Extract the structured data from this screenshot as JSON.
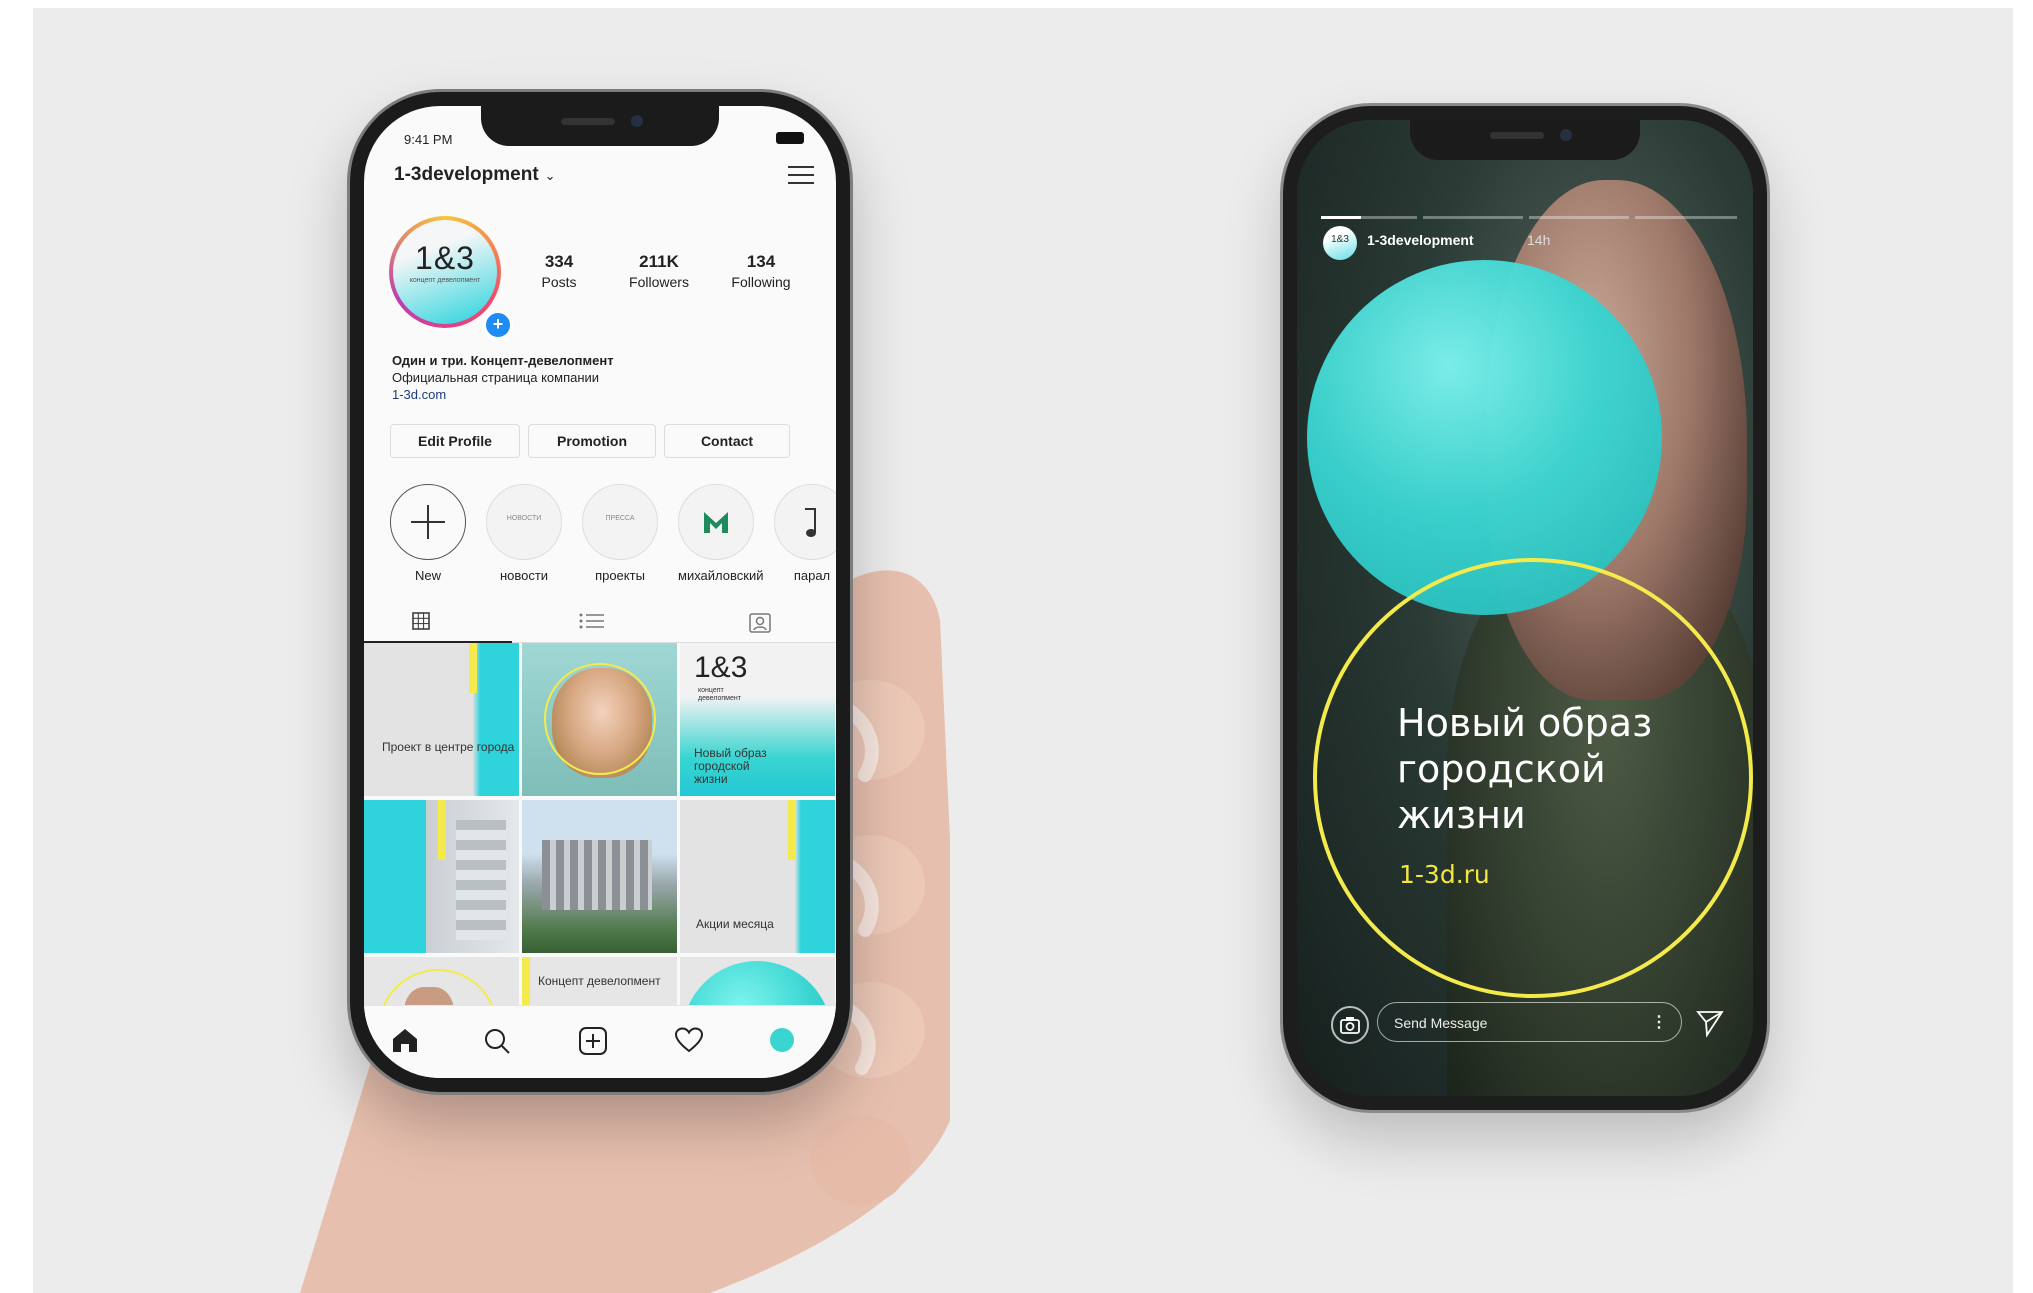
{
  "profile_phone": {
    "status_time": "9:41 PM",
    "username": "1-3development",
    "avatar": {
      "logo": "1&3",
      "subtitle": "концепт девелопмент"
    },
    "stats": [
      {
        "value": "334",
        "label": "Posts"
      },
      {
        "value": "211K",
        "label": "Followers"
      },
      {
        "value": "134",
        "label": "Following"
      }
    ],
    "bio": {
      "name": "Один и три. Концепт-девелопмент",
      "description": "Официальная страница компании",
      "link": "1-3d.com"
    },
    "buttons": {
      "edit_profile": "Edit Profile",
      "promotion": "Promotion",
      "contact": "Contact"
    },
    "highlights": [
      {
        "label": "New",
        "inner": ""
      },
      {
        "label": "новости",
        "inner": "НОВОСТИ"
      },
      {
        "label": "проекты",
        "inner": "ПРЕССА"
      },
      {
        "label": "михайловский",
        "inner": ""
      },
      {
        "label": "парал",
        "inner": ""
      }
    ],
    "grid_posts": {
      "p1": "Проект в центре города",
      "p3_logo": "1&3",
      "p3_sub": "концепт девелопмент",
      "p3_text": "Новый образ городской жизни",
      "p6": "Акции месяца",
      "p8": "Концепт девелопмент"
    }
  },
  "story_phone": {
    "username": "1-3development",
    "time": "14h",
    "avatar_logo": "1&3",
    "headline": "Новый образ городской жизни",
    "url": "1-3d.ru",
    "message_placeholder": "Send Message"
  },
  "colors": {
    "teal": "#3ad5d1",
    "yellow": "#f4ea4c",
    "instagram_blue": "#1f8cf5"
  }
}
